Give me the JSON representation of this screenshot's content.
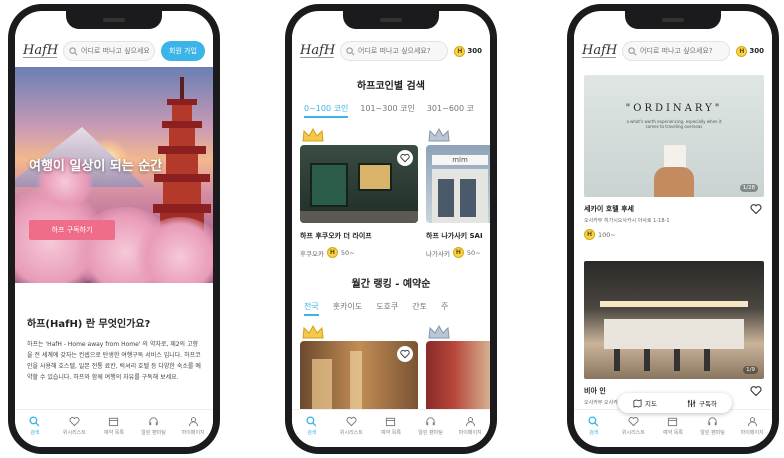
{
  "phone1": {
    "search_placeholder": "어디로 떠나고 싶으세요?",
    "join_label": "회원 가입",
    "hero_title": "여행이 일상이 되는 순간",
    "hero_button": "하프 구독하기",
    "about_title": "하프(HafH) 란 무엇인가요?",
    "about_body": "하프는 'HafH - Home away from Home' 의 약자로, 제2의 고향을 전 세계에 갖자는 컨셉으로 탄생한 여행구독 서비스 입니다. 하프코인을 사용해 호스텔, 일본 전통 료칸, 럭셔리 호텔 등 다양한 숙소를 예약할 수 있습니다. 하프와 함께 여행의 자유를 구독해 보세요."
  },
  "logo_text": "HafH",
  "coin_balance": "300",
  "coin_symbol": "H",
  "tabs": [
    {
      "label": "검색",
      "icon": "search-icon"
    },
    {
      "label": "위시리스트",
      "icon": "heart-icon"
    },
    {
      "label": "예약 목록",
      "icon": "calendar-icon"
    },
    {
      "label": "알린 팬미팅",
      "icon": "headset-icon"
    },
    {
      "label": "마이페이지",
      "icon": "person-icon"
    }
  ],
  "phone2": {
    "coin_section_title": "하프코인별 검색",
    "coin_filters": [
      "0~100 코인",
      "101~300 코인",
      "301~600 코"
    ],
    "cards": [
      {
        "name": "하프 후쿠오카 더 라이프",
        "city": "후쿠오카",
        "price": "50~"
      },
      {
        "name": "하프 나가사키 SAI",
        "city": "나가사키",
        "price": "50~"
      }
    ],
    "ranking_title": "월간 랭킹 - 예약순",
    "regions": [
      "전국",
      "홋카이도",
      "도호쿠",
      "간토",
      "주"
    ]
  },
  "phone3": {
    "card1": {
      "sign": "\"ORDINARY\"",
      "caption": "a what's worth experiencing, especially when it comes to traveling overseas",
      "counter": "1/28",
      "name": "세카이 호텔 후세",
      "address": "오사카부 히가시오사카시 아사로 1-18-1",
      "price": "100~"
    },
    "card2": {
      "counter": "1/9",
      "name": "비아 인",
      "address": "오사카부 오사카시..."
    },
    "map_label": "지도",
    "filter_label": "구독하"
  },
  "colors": {
    "accent": "#3bb5e8",
    "pink": "#f06d8a",
    "coin": "#f7d44c"
  }
}
